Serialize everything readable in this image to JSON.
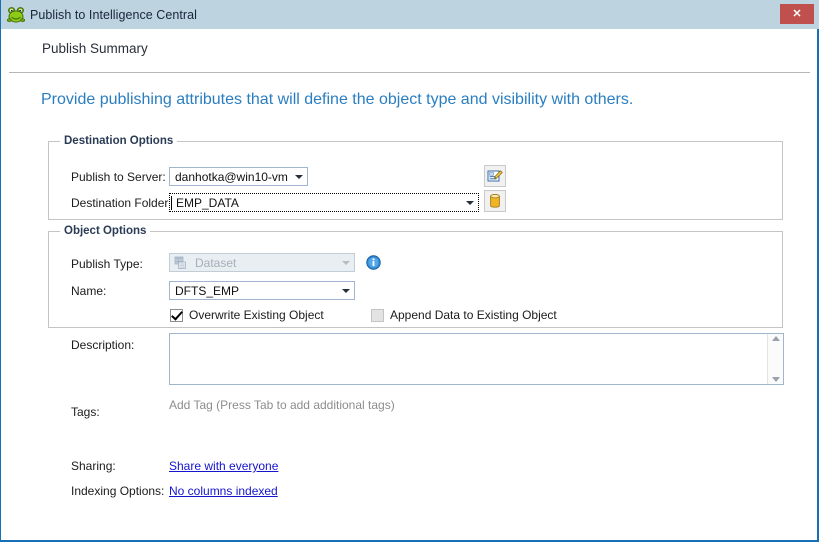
{
  "window": {
    "title": "Publish to Intelligence Central",
    "app_icon": "frog-icon",
    "close_label": "✕",
    "title_bar_color": "#bed3e0",
    "border_color": "#1570b8",
    "close_button_color": "#c0504d"
  },
  "header": {
    "title": "Publish Summary"
  },
  "intro": {
    "text": "Provide publishing attributes that will define the object type and visibility with others.",
    "color": "#2a7ec0"
  },
  "destination_options": {
    "legend": "Destination Options",
    "publish_to_server": {
      "label": "Publish to Server:",
      "value": "danhotka@win10-vm",
      "focused": false,
      "button_icon": "server-settings-icon"
    },
    "destination_folder": {
      "label": "Destination Folder:",
      "value": "EMP_DATA",
      "focused": true,
      "button_icon": "database-folder-icon"
    }
  },
  "object_options": {
    "legend": "Object Options",
    "publish_type": {
      "label": "Publish Type:",
      "value": "Dataset",
      "disabled": true,
      "glyph": "dataset-icon",
      "info_icon": "info-icon"
    },
    "name": {
      "label": "Name:",
      "value": "DFTS_EMP",
      "disabled": false
    },
    "overwrite_existing": {
      "label": "Overwrite Existing Object",
      "checked": true,
      "disabled": false
    },
    "append_data": {
      "label": "Append Data to Existing Object",
      "checked": false,
      "disabled": true
    }
  },
  "description": {
    "label": "Description:",
    "value": "",
    "placeholder": ""
  },
  "tags": {
    "label": "Tags:",
    "placeholder": "Add Tag (Press Tab to add additional tags)",
    "value": ""
  },
  "sharing": {
    "label": "Sharing:",
    "link_text": "Share with everyone"
  },
  "indexing": {
    "label": "Indexing Options:",
    "link_text": "No columns indexed"
  },
  "link_color": "#1414cc"
}
